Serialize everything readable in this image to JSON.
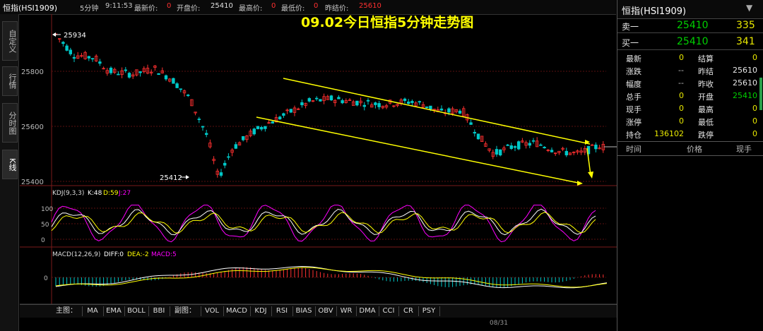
{
  "titlebar": {
    "symbol": "恒指(HSI1909)",
    "period": "5分钟",
    "time": "9:11:53",
    "latest_label": "最新价:",
    "latest_value": "0",
    "open_label": "开盘价:",
    "open_value": "25410",
    "high_label": "最高价:",
    "high_value": "0",
    "low_label": "最低价:",
    "low_value": "0",
    "prevclose_label": "昨结价:",
    "prevclose_value": "25610"
  },
  "left_tabs": [
    "自定义",
    "行情",
    "分时图",
    "K线"
  ],
  "chart": {
    "title": "09.02今日恒指5分钟走势图",
    "price_ticks": [
      "25800",
      "25600",
      "25400"
    ],
    "high_annotation": "25934",
    "low_annotation": "25412",
    "kdj_header": {
      "name": "KDJ(9,3,3)",
      "k": "K:48",
      "d": "D:59",
      "j": "J:27"
    },
    "kdj_ticks": [
      "100",
      "50",
      "0"
    ],
    "macd_header": {
      "name": "MACD(12,26,9)",
      "diff": "DIFF:0",
      "dea": "DEA:-2",
      "macd": "MACD:5"
    },
    "macd_ticks": [
      "0"
    ],
    "date_label": "08/31"
  },
  "bottom_tabs": [
    "主图：",
    "MA",
    "EMA",
    "BOLL",
    "BBI",
    "副图：",
    "VOL",
    "MACD",
    "KDJ",
    "RSI",
    "BIAS",
    "OBV",
    "WR",
    "DMA",
    "CCI",
    "CR",
    "PSY"
  ],
  "panel": {
    "title": "恒指(HSI1909)",
    "dropdown_icon": "chevron-down-icon",
    "sell1": {
      "label": "卖一",
      "price": "25410",
      "qty": "335"
    },
    "buy1": {
      "label": "买一",
      "price": "25410",
      "qty": "341"
    },
    "stats": [
      {
        "l1": "最新",
        "v1": "0",
        "l2": "结算",
        "v2": "0"
      },
      {
        "l1": "涨跌",
        "v1": "--",
        "l2": "昨结",
        "v2": "25610"
      },
      {
        "l1": "幅度",
        "v1": "--",
        "l2": "昨收",
        "v2": "25610"
      },
      {
        "l1": "总手",
        "v1": "0",
        "l2": "开盘",
        "v2": "25410"
      },
      {
        "l1": "现手",
        "v1": "0",
        "l2": "最高",
        "v2": "0"
      },
      {
        "l1": "涨停",
        "v1": "0",
        "l2": "最低",
        "v2": "0"
      },
      {
        "l1": "持仓",
        "v1": "136102",
        "l2": "跌停",
        "v2": "0"
      }
    ],
    "tick_headers": [
      "时间",
      "价格",
      "现手"
    ]
  },
  "colors": {
    "up": "#ff3030",
    "down": "#00c8c8",
    "trend": "#ffff00",
    "k": "#ffffff",
    "d": "#ffff00",
    "j": "#ff00ff"
  }
}
